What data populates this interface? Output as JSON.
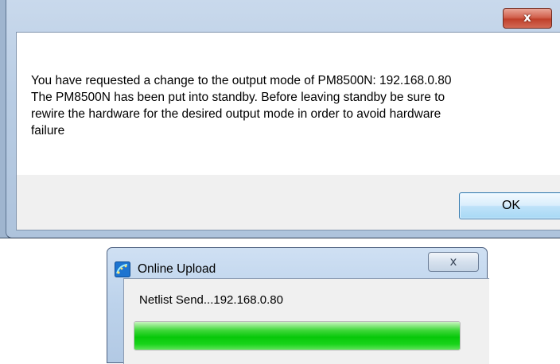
{
  "message_dialog": {
    "close_glyph": "x",
    "message_lines": [
      "You have requested a change to the output mode of PM8500N: 192.168.0.80",
      "The PM8500N has been put into standby. Before leaving standby be sure to",
      "rewire the hardware for the desired output mode in order to avoid hardware",
      "failure"
    ],
    "ok_label": "OK"
  },
  "upload_window": {
    "title": "Online Upload",
    "icon": "app-icon",
    "close_glyph": "x",
    "status_text": "Netlist Send...192.168.0.80",
    "progress": 1.0
  },
  "colors": {
    "progress_green": "#07c80a",
    "close_red": "#c0402b",
    "frame_blue": "#b9cde4"
  }
}
